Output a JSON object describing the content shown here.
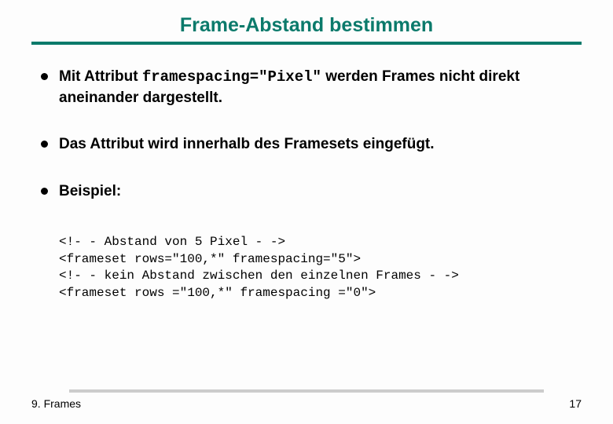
{
  "title": "Frame-Abstand bestimmen",
  "bullets": [
    {
      "pre": "Mit Attribut ",
      "code": "framespacing=\"Pixel\"",
      "post": " werden Frames nicht direkt aneinander dargestellt."
    },
    {
      "pre": "Das Attribut wird innerhalb des Framesets eingefügt.",
      "code": "",
      "post": ""
    },
    {
      "pre": "Beispiel:",
      "code": "",
      "post": ""
    }
  ],
  "code_lines": [
    "<!- - Abstand von 5 Pixel - ->",
    "<frameset rows=\"100,*\" framespacing=\"5\">",
    "<!- - kein Abstand zwischen den einzelnen Frames - ->",
    "<frameset rows =\"100,*\" framespacing =\"0\">"
  ],
  "footer": {
    "left": "9. Frames",
    "right": "17"
  }
}
